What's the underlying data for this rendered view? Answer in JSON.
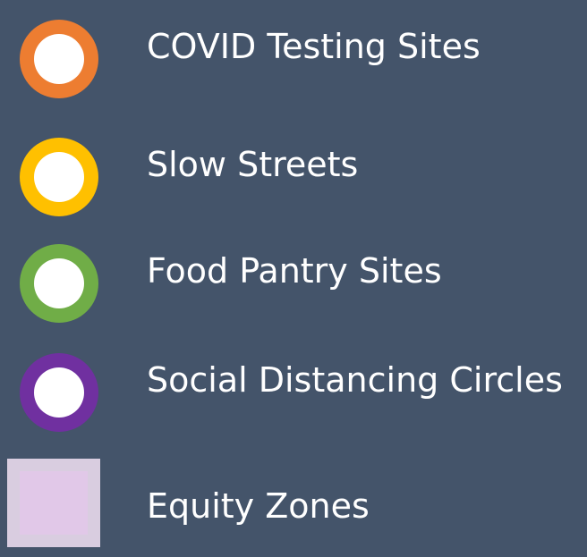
{
  "legend": {
    "background_color": "#44546a",
    "items": [
      {
        "label": "COVID Testing Sites",
        "symbol": "ring",
        "color": "#ed7d31",
        "fill": "#ffffff"
      },
      {
        "label": "Slow Streets",
        "symbol": "ring",
        "color": "#ffc000",
        "fill": "#ffffff"
      },
      {
        "label": "Food Pantry Sites",
        "symbol": "ring",
        "color": "#70ad47",
        "fill": "#ffffff"
      },
      {
        "label": "Social Distancing Circles",
        "symbol": "ring",
        "color": "#7030a0",
        "fill": "#ffffff"
      },
      {
        "label": "Equity Zones",
        "symbol": "square",
        "color": "#e1c8e8",
        "border_color": "#d9cde0"
      }
    ]
  }
}
